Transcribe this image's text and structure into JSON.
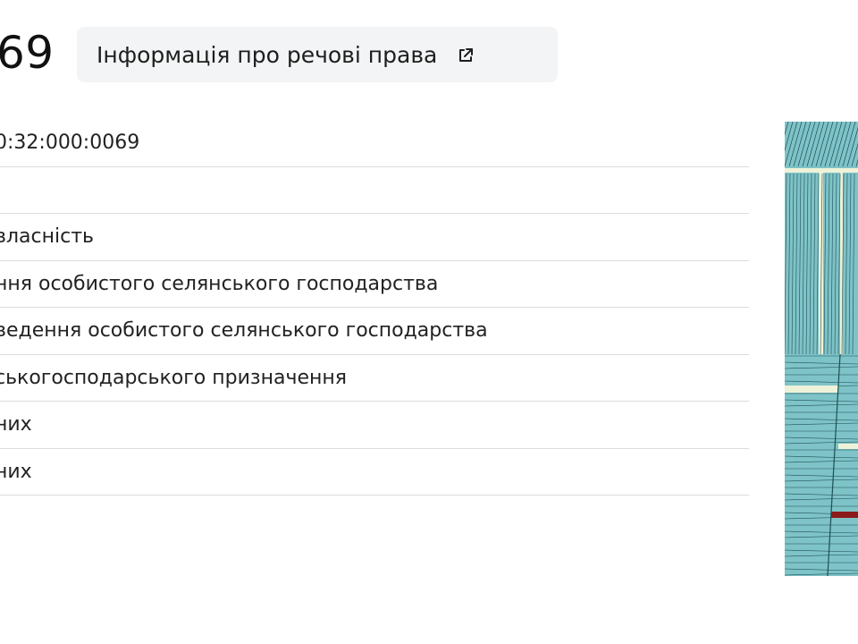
{
  "header": {
    "title": "69",
    "rights_button_label": "Інформація про речові права",
    "rights_button_icon": "external-link-icon"
  },
  "details": {
    "rows": [
      "0:32:000:0069",
      "",
      "власність",
      "ння особистого селянського господарства",
      "ведення особистого селянського господарства",
      "ськогосподарського призначення",
      "них",
      "них"
    ]
  },
  "map": {
    "colors": {
      "parcel_fill": "#7ec3c7",
      "parcel_line": "#1c4f56",
      "road": "#eef2d8",
      "highlight": "#8b1a1a"
    }
  }
}
